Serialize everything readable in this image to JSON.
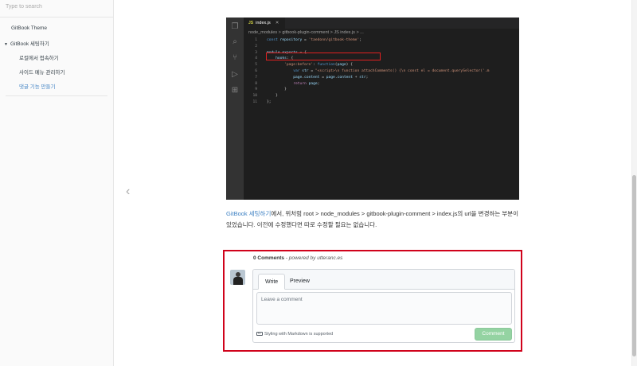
{
  "search": {
    "placeholder": "Type to search"
  },
  "sidebar": {
    "items": [
      {
        "label": "GitBook Theme"
      },
      {
        "label": "GitBook 세팅하기"
      },
      {
        "label": "로컬에서 접속하기"
      },
      {
        "label": "사이드 메뉴 관리하기"
      },
      {
        "label": "댓글 기능 만들기"
      }
    ]
  },
  "editor": {
    "tab_label": "index.js",
    "tab_icon": "JS",
    "breadcrumb": "node_modules > gitbook-plugin-comment > JS index.js > ...",
    "line_numbers": [
      "1",
      "2",
      "3",
      "4",
      "5",
      "6",
      "7",
      "8",
      "9",
      "10",
      "11"
    ],
    "code_lines": [
      "const repository = 'taedonn/gitbook-theme';",
      "",
      "module.exports = {",
      "    hooks: {",
      "        'page:before': function(page) {",
      "            var str = \"<script>\\n function attachComments() {\\n const el = document.querySelector('.m",
      "            page.content = page.content + str;",
      "            return page;",
      "        }",
      "    }",
      "};"
    ]
  },
  "article": {
    "link_text": "GitBook 세팅하기",
    "paragraph": "에서, 위처럼 root > node_modules > gitbook-plugin-comment > index.js의 url을 변경하는 부분이 있었습니다. 이전에 수정했다면 따로 수정할 필요는 없습니다."
  },
  "comments": {
    "count_label": "0 Comments",
    "separator": " - ",
    "powered_by": "powered by utteranc.es",
    "tab_write": "Write",
    "tab_preview": "Preview",
    "textarea_placeholder": "Leave a comment",
    "markdown_note": "Styling with Markdown is supported",
    "submit_label": "Comment"
  },
  "colors": {
    "accent": "#4183c4",
    "highlight_border": "#d0021b",
    "comment_button": "#94d3a2"
  }
}
